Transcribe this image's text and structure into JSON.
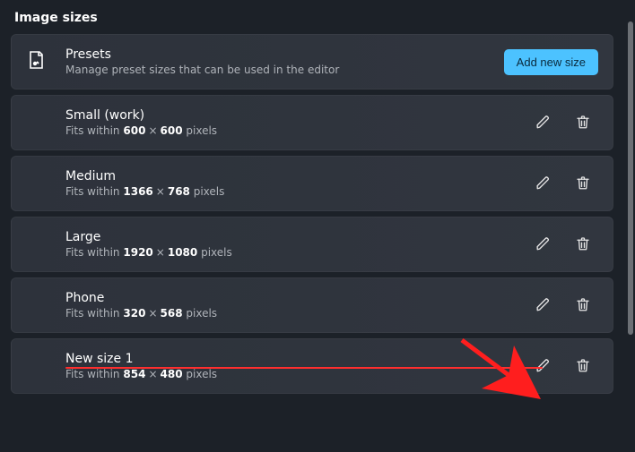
{
  "section": {
    "title": "Image sizes"
  },
  "presets": {
    "title": "Presets",
    "subtitle": "Manage preset sizes that can be used in the editor",
    "add_label": "Add new size"
  },
  "fits_label": "Fits within",
  "pixels_label": "pixels",
  "items": [
    {
      "name": "Small (work)",
      "w": "600",
      "h": "600"
    },
    {
      "name": "Medium",
      "w": "1366",
      "h": "768"
    },
    {
      "name": "Large",
      "w": "1920",
      "h": "1080"
    },
    {
      "name": "Phone",
      "w": "320",
      "h": "568"
    },
    {
      "name": "New size 1",
      "w": "854",
      "h": "480",
      "highlight": true
    }
  ]
}
